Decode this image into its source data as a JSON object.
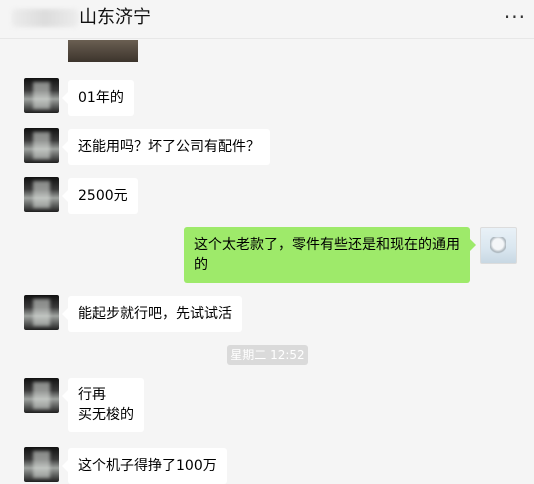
{
  "header": {
    "title": "山东济宁",
    "more_icon": "more-horizontal-icon",
    "more_glyph": "···"
  },
  "messages": [
    {
      "from": "other",
      "text": "01年的"
    },
    {
      "from": "other",
      "text": "还能用吗？坏了公司有配件？"
    },
    {
      "from": "other",
      "text": "2500元"
    },
    {
      "from": "me",
      "text": "这个太老款了，零件有些还是和现在的通用的"
    },
    {
      "from": "other",
      "text": "能起步就行吧，先试试活"
    },
    {
      "from": "other",
      "lines": [
        "行再",
        "买无梭的"
      ]
    },
    {
      "from": "other",
      "text": "这个机子得挣了100万"
    }
  ],
  "timestamp": "星期二 12:52",
  "colors": {
    "background": "#f5f5f5",
    "incoming_bubble": "#ffffff",
    "outgoing_bubble": "#9eea6a",
    "timestamp_chip": "#dadada"
  }
}
